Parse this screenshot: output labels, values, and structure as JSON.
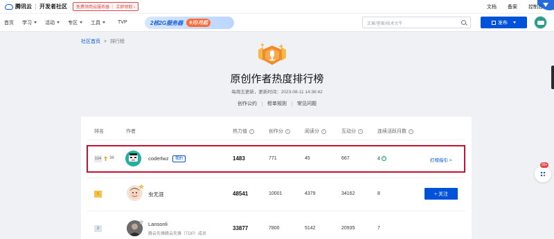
{
  "topbar": {
    "brand": "腾讯云",
    "community": "开发者社区",
    "promo": "免费领用云服务器 ｜ 立即领取 ›",
    "right_links": [
      "文档",
      "备案",
      "控制台"
    ]
  },
  "nav": {
    "items": [
      {
        "label": "首页",
        "dropdown": false
      },
      {
        "label": "学习",
        "dropdown": true
      },
      {
        "label": "活动",
        "dropdown": true
      },
      {
        "label": "专区",
        "dropdown": true
      },
      {
        "label": "工具",
        "dropdown": true
      },
      {
        "label": "TVP",
        "dropdown": false
      }
    ],
    "banner_text": "2核2G服务器",
    "banner_price": "9元/月起",
    "search_placeholder": "文章/答案/技术大牛",
    "publish_label": "发布"
  },
  "breadcrumb": {
    "home": "社区首页",
    "sep": ">",
    "current": "排行榜"
  },
  "page": {
    "title": "原创作者热度排行榜",
    "update_text": "每周五更新，更新时间：2023-08-11 14:36:42",
    "links": [
      "创作公约",
      "榜单规则",
      "常见问题"
    ]
  },
  "table": {
    "headers": {
      "rank": "排名",
      "author": "作者",
      "hot": "热力值",
      "create": "创作分",
      "read": "阅读分",
      "interact": "互动分",
      "active": "连续活跃月数"
    },
    "my_row": {
      "rank": "104",
      "change": "36",
      "name": "coderlwz",
      "tag": "我的",
      "hot": "1483",
      "create": "771",
      "read": "45",
      "interact": "667",
      "active": "4",
      "guide": "打榜指引 >"
    },
    "rows": [
      {
        "rank": "1",
        "name": "虫无涯",
        "subtitle": "",
        "hot": "48541",
        "create": "10001",
        "read": "4379",
        "interact": "34162",
        "active": "8",
        "follow": "+ 关注"
      },
      {
        "rank": "2",
        "name": "Lansonli",
        "subtitle": "腾云先锋腾云先锋（TDP）成员",
        "hot": "33877",
        "create": "7800",
        "read": "5142",
        "interact": "20935",
        "active": "7"
      }
    ]
  },
  "side": {
    "badge": "99+"
  },
  "colors": {
    "primary": "#0052d9",
    "highlight": "#c8102e",
    "gold": "#f0a020"
  }
}
